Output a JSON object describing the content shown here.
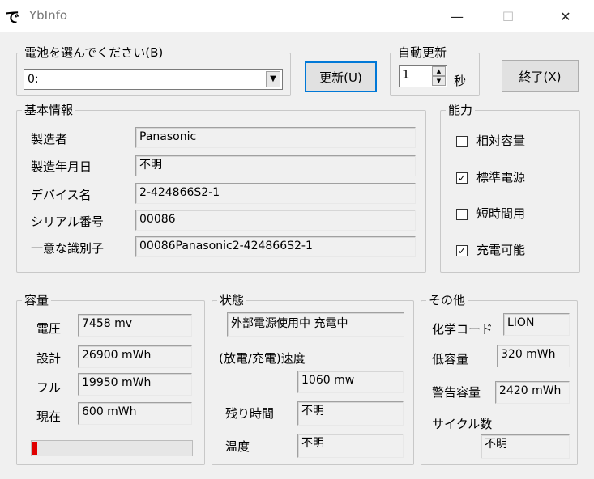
{
  "window": {
    "title": "YbInfo",
    "icon_glyph": "で",
    "minimize": "—",
    "maximize": "☐",
    "close": "✕"
  },
  "battery_select": {
    "label": "電池を選んでください(B)",
    "value": "0:"
  },
  "buttons": {
    "refresh": "更新(U)",
    "exit": "終了(X)"
  },
  "auto_refresh": {
    "label": "自動更新",
    "value": "1",
    "unit": "秒"
  },
  "basic": {
    "title": "基本情報",
    "rows": [
      {
        "label": "製造者",
        "value": "Panasonic"
      },
      {
        "label": "製造年月日",
        "value": "不明"
      },
      {
        "label": "デバイス名",
        "value": "2-424866S2-1"
      },
      {
        "label": "シリアル番号",
        "value": "00086"
      },
      {
        "label": "一意な識別子",
        "value": "00086Panasonic2-424866S2-1"
      }
    ]
  },
  "capability": {
    "title": "能力",
    "items": [
      {
        "label": "相対容量",
        "mark": ""
      },
      {
        "label": "標準電源",
        "mark": "✓"
      },
      {
        "label": "短時間用",
        "mark": ""
      },
      {
        "label": "充電可能",
        "mark": "✓"
      }
    ]
  },
  "capacity": {
    "title": "容量",
    "rows": [
      {
        "label": "電圧",
        "value": "7458 mv"
      },
      {
        "label": "設計",
        "value": "26900 mWh"
      },
      {
        "label": "フル",
        "value": "19950 mWh"
      },
      {
        "label": "現在",
        "value": "600 mWh"
      }
    ],
    "progress_fraction": 0.03
  },
  "status": {
    "title": "状態",
    "state": "外部電源使用中 充電中",
    "rate_label": "(放電/充電)速度",
    "rate_value": "1060 mw",
    "remaining_label": "残り時間",
    "remaining_value": "不明",
    "temp_label": "温度",
    "temp_value": "不明"
  },
  "other": {
    "title": "その他",
    "chem_label": "化学コード",
    "chem_value": "LION",
    "low_label": "低容量",
    "low_value": "320 mWh",
    "warn_label": "警告容量",
    "warn_value": "2420 mWh",
    "cycle_label": "サイクル数",
    "cycle_value": "不明"
  },
  "colors": {
    "accent": "#0078d7",
    "progress": "#e00000",
    "background": "#f0f0f0"
  }
}
